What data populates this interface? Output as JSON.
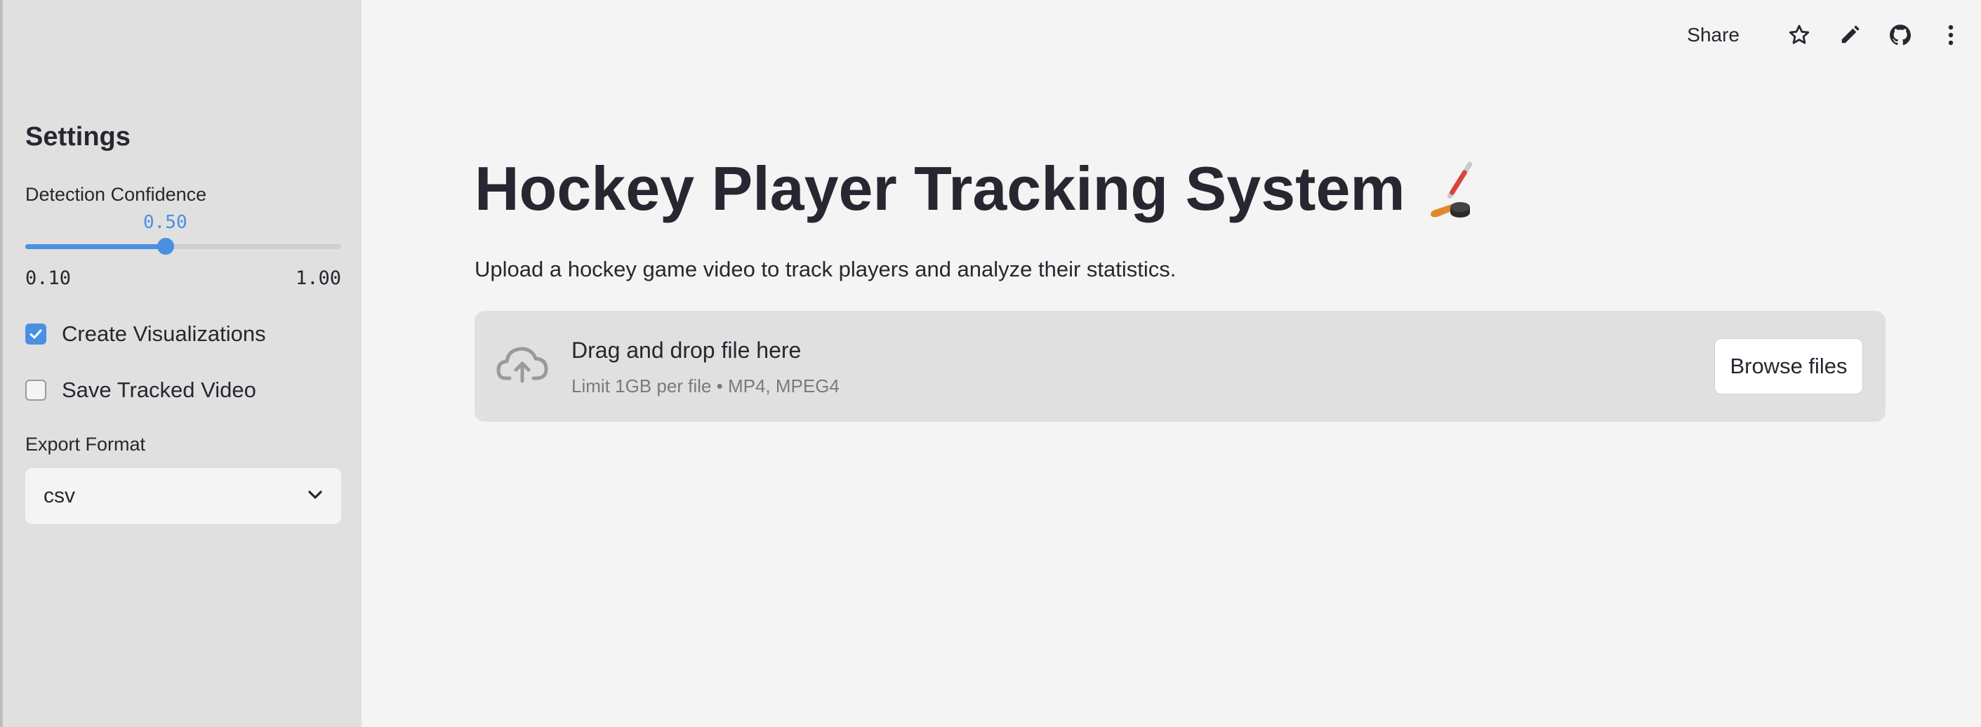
{
  "sidebar": {
    "title": "Settings",
    "confidence": {
      "label": "Detection Confidence",
      "value_text": "0.50",
      "value": 0.5,
      "min_text": "0.10",
      "max_text": "1.00",
      "min": 0.1,
      "max": 1.0
    },
    "checkboxes": [
      {
        "label": "Create Visualizations",
        "checked": true
      },
      {
        "label": "Save Tracked Video",
        "checked": false
      }
    ],
    "export": {
      "label": "Export Format",
      "selected": "csv"
    }
  },
  "topbar": {
    "share_label": "Share",
    "icons": [
      "star-icon",
      "pencil-icon",
      "github-icon",
      "more-vertical-icon"
    ]
  },
  "main": {
    "title": "Hockey Player Tracking System",
    "subtitle": "Upload a hockey game video to track players and analyze their statistics.",
    "uploader": {
      "drop_text": "Drag and drop file here",
      "limit_text": "Limit 1GB per file • MP4, MPEG4",
      "button_label": "Browse files"
    }
  },
  "colors": {
    "accent": "#4a90e2",
    "sidebar_bg": "#e0e0e0",
    "page_bg": "#f4f4f4",
    "text": "#262730"
  }
}
